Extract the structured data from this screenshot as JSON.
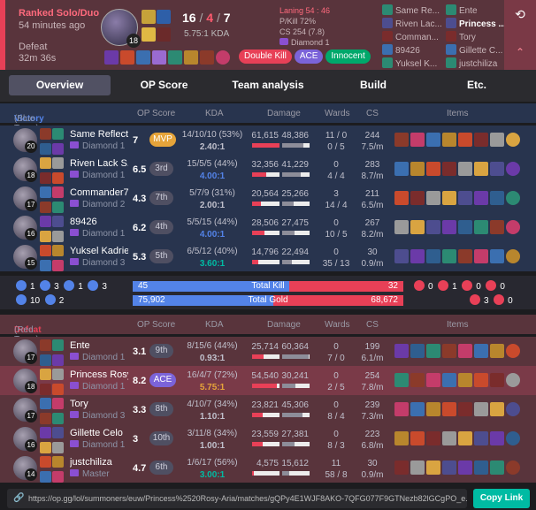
{
  "header": {
    "mode": "Ranked Solo/Duo",
    "time_ago": "54 minutes ago",
    "result": "Defeat",
    "duration": "32m 36s",
    "champ_level": "18",
    "kills": "16",
    "deaths": "4",
    "assists": "7",
    "kda_ratio": "5.75:1 KDA",
    "laning": "Laning 54 : 46",
    "pkill": "P/Kill 72%",
    "cs": "CS 254 (7.8)",
    "rank": "Diamond 1",
    "badges": [
      "Double Kill",
      "ACE",
      "Innocent"
    ],
    "badge_colors": [
      "#e84057",
      "#7b63d9",
      "#00a86b"
    ],
    "participants_left": [
      "Same Re...",
      "Riven Lac...",
      "Comman...",
      "89426",
      "Yuksel K..."
    ],
    "participants_right": [
      "Ente",
      "Princess ...",
      "Tory",
      "Gillette C...",
      "justchiliza"
    ]
  },
  "tabs": [
    "Overview",
    "OP Score",
    "Team analysis",
    "Build",
    "Etc."
  ],
  "blue_team": {
    "label": "Victory",
    "sub": "(Blue Team)",
    "headers": {
      "op": "OP Score",
      "kda": "KDA",
      "dmg": "Damage",
      "wards": "Wards",
      "cs": "CS",
      "items": "Items"
    },
    "players": [
      {
        "level": "20",
        "name": "Same Reflect",
        "tier": "Diamond 1",
        "score": "7",
        "rank": "MVP",
        "kda": "14/10/10 (53%)",
        "ratio": "2.40:1",
        "ratio_color": "#c0c0cc",
        "dmg1": "61,615",
        "dmg2": "48,386",
        "b1": 1.0,
        "b2": 0.79,
        "wards": "11 / 0",
        "wards2": "0 / 5",
        "cs": "244",
        "cs2": "7.5/m"
      },
      {
        "level": "18",
        "name": "Riven Lack S...",
        "tier": "Diamond 1",
        "score": "6.5",
        "rank": "3rd",
        "kda": "15/5/5 (44%)",
        "ratio": "4.00:1",
        "ratio_color": "#5383e8",
        "dmg1": "32,356",
        "dmg2": "41,229",
        "b1": 0.53,
        "b2": 0.67,
        "wards": "0",
        "wards2": "4 / 4",
        "cs": "283",
        "cs2": "8.7/m"
      },
      {
        "level": "17",
        "name": "Commander71",
        "tier": "Diamond 2",
        "score": "4.3",
        "rank": "7th",
        "kda": "5/7/9 (31%)",
        "ratio": "2.00:1",
        "ratio_color": "#c0c0cc",
        "dmg1": "20,564",
        "dmg2": "25,266",
        "b1": 0.33,
        "b2": 0.41,
        "wards": "3",
        "wards2": "14 / 4",
        "cs": "211",
        "cs2": "6.5/m"
      },
      {
        "level": "16",
        "name": "89426",
        "tier": "Diamond 1",
        "score": "6.2",
        "rank": "4th",
        "kda": "5/5/15 (44%)",
        "ratio": "4.00:1",
        "ratio_color": "#5383e8",
        "dmg1": "28,506",
        "dmg2": "27,475",
        "b1": 0.46,
        "b2": 0.45,
        "wards": "0",
        "wards2": "10 / 5",
        "cs": "267",
        "cs2": "8.2/m"
      },
      {
        "level": "15",
        "name": "Yuksel Kadriev",
        "tier": "Diamond 3",
        "score": "5.3",
        "rank": "5th",
        "kda": "6/5/12 (40%)",
        "ratio": "3.60:1",
        "ratio_color": "#00bba3",
        "dmg1": "14,796",
        "dmg2": "22,494",
        "b1": 0.24,
        "b2": 0.36,
        "wards": "0",
        "wards2": "35 / 13",
        "cs": "30",
        "cs2": "0.9/m"
      }
    ]
  },
  "summary": {
    "blue_objs": [
      "1",
      "3",
      "1",
      "3",
      "10",
      "2"
    ],
    "red_objs": [
      "0",
      "1",
      "0",
      "0",
      "3",
      "0"
    ],
    "blue_kill": "45",
    "red_kill": "32",
    "kill_label": "Total Kill",
    "blue_gold": "75,902",
    "red_gold": "68,672",
    "gold_label": "Total Gold",
    "kill_ratio": 0.58,
    "gold_ratio": 0.52
  },
  "red_team": {
    "label": "Defeat",
    "sub": "(Red Team)",
    "headers": {
      "op": "OP Score",
      "kda": "KDA",
      "dmg": "Damage",
      "wards": "Wards",
      "cs": "CS",
      "items": "Items"
    },
    "players": [
      {
        "level": "17",
        "name": "Ente",
        "tier": "Diamond 1",
        "score": "3.1",
        "rank": "9th",
        "kda": "8/15/6 (44%)",
        "ratio": "0.93:1",
        "ratio_color": "#c0c0cc",
        "dmg1": "25,714",
        "dmg2": "60,364",
        "b1": 0.42,
        "b2": 0.98,
        "wards": "0",
        "wards2": "7 / 0",
        "cs": "199",
        "cs2": "6.1/m",
        "me": false
      },
      {
        "level": "18",
        "name": "Princess Rosy",
        "tier": "Diamond 1",
        "score": "8.2",
        "rank": "ACE",
        "kda": "16/4/7 (72%)",
        "ratio": "5.75:1",
        "ratio_color": "#e6a43a",
        "dmg1": "54,540",
        "dmg2": "30,241",
        "b1": 0.89,
        "b2": 0.49,
        "wards": "0",
        "wards2": "2 / 5",
        "cs": "254",
        "cs2": "7.8/m",
        "me": true
      },
      {
        "level": "17",
        "name": "Tory",
        "tier": "Diamond 3",
        "score": "3.3",
        "rank": "8th",
        "kda": "4/10/7 (34%)",
        "ratio": "1.10:1",
        "ratio_color": "#c0c0cc",
        "dmg1": "23,821",
        "dmg2": "45,306",
        "b1": 0.39,
        "b2": 0.74,
        "wards": "0",
        "wards2": "8 / 4",
        "cs": "239",
        "cs2": "7.3/m",
        "me": false
      },
      {
        "level": "16",
        "name": "Gillette Celo",
        "tier": "Diamond 1",
        "score": "3",
        "rank": "10th",
        "kda": "3/11/8 (34%)",
        "ratio": "1.00:1",
        "ratio_color": "#c0c0cc",
        "dmg1": "23,559",
        "dmg2": "27,381",
        "b1": 0.38,
        "b2": 0.44,
        "wards": "0",
        "wards2": "8 / 3",
        "cs": "223",
        "cs2": "6.8/m",
        "me": false
      },
      {
        "level": "14",
        "name": "justchiliza",
        "tier": "Master",
        "score": "4.7",
        "rank": "6th",
        "kda": "1/6/17 (56%)",
        "ratio": "3.00:1",
        "ratio_color": "#00bba3",
        "dmg1": "4,575",
        "dmg2": "15,612",
        "b1": 0.07,
        "b2": 0.25,
        "wards": "11",
        "wards2": "58 / 8",
        "cs": "30",
        "cs2": "0.9/m",
        "me": false
      }
    ]
  },
  "url": "https://op.gg/lol/summoners/euw/Princess%2520Rosy-Aria/matches/gQPy4E1WJF8AKO-7QFG077F9GTNezb82lGCgPO_e...",
  "copy_label": "Copy Link",
  "item_palette": [
    "#8b3a2a",
    "#d9a441",
    "#3b6fb0",
    "#6b3aa8",
    "#c94a2c",
    "#2c8a73",
    "#9a9a9a",
    "#c43c6a",
    "#4d4d8f",
    "#b8862d",
    "#2f5e8f",
    "#7a2c2c"
  ]
}
